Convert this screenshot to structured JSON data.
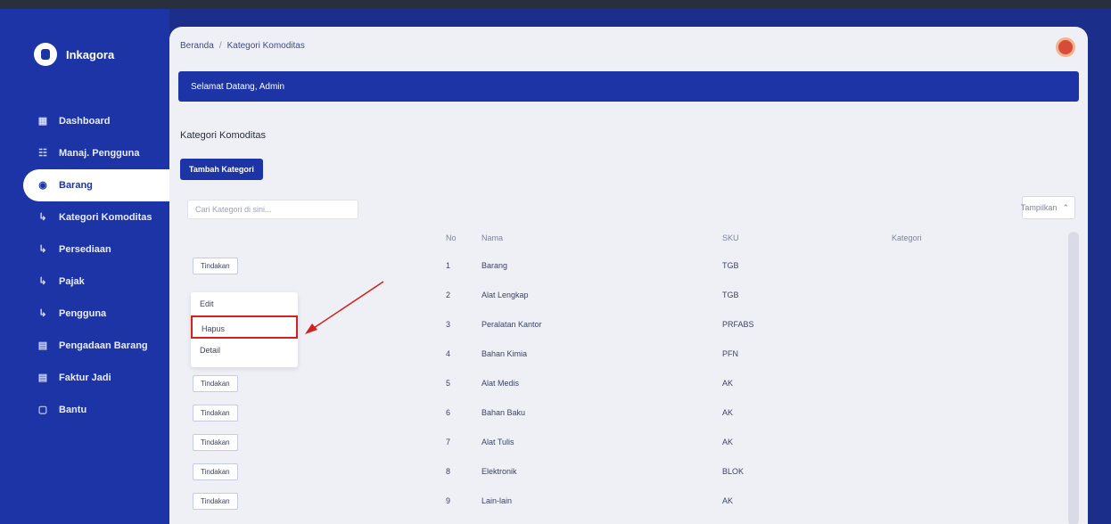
{
  "app": {
    "name": "Inkagora"
  },
  "sidebar": {
    "items": [
      {
        "label": "Dashboard",
        "icon": "grid-icon"
      },
      {
        "label": "Manaj. Pengguna",
        "icon": "users-icon"
      },
      {
        "label": "Barang",
        "icon": "box-icon"
      },
      {
        "label": "Kategori Komoditas",
        "icon": "tag-icon"
      },
      {
        "label": "Persediaan",
        "icon": "list-icon"
      },
      {
        "label": "Pajak",
        "icon": "tag-icon"
      },
      {
        "label": "Pengguna",
        "icon": "user-icon"
      },
      {
        "label": "Pengadaan Barang",
        "icon": "cart-icon"
      },
      {
        "label": "Faktur Jadi",
        "icon": "doc-icon"
      },
      {
        "label": "Bantu",
        "icon": "help-icon"
      }
    ]
  },
  "breadcrumb": {
    "home": "Beranda",
    "current": "Kategori Komoditas"
  },
  "banner": {
    "text": "Selamat Datang, Admin"
  },
  "page": {
    "title": "Kategori Komoditas",
    "add_button": "Tambah Kategori"
  },
  "search": {
    "placeholder": "Cari Kategori di sini..."
  },
  "table_ctrl": {
    "label": "Tampilkan"
  },
  "table": {
    "headers": {
      "action": "",
      "no": "No",
      "nama": "Nama",
      "sku": "SKU",
      "kategori": "Kategori"
    },
    "rows": [
      {
        "action": "Tindakan",
        "no": "1",
        "nama": "Barang",
        "sku": "TGB",
        "kategori": ""
      },
      {
        "action": "",
        "no": "2",
        "nama": "Alat Lengkap",
        "sku": "TGB",
        "kategori": ""
      },
      {
        "action": "",
        "no": "3",
        "nama": "Peralatan Kantor",
        "sku": "PRFABS",
        "kategori": ""
      },
      {
        "action": "",
        "no": "4",
        "nama": "Bahan Kimia",
        "sku": "PFN",
        "kategori": ""
      },
      {
        "action": "Tindakan",
        "no": "5",
        "nama": "Alat Medis",
        "sku": "AK",
        "kategori": ""
      },
      {
        "action": "Tindakan",
        "no": "6",
        "nama": "Bahan Baku",
        "sku": "AK",
        "kategori": ""
      },
      {
        "action": "Tindakan",
        "no": "7",
        "nama": "Alat Tulis",
        "sku": "AK",
        "kategori": ""
      },
      {
        "action": "Tindakan",
        "no": "8",
        "nama": "Elektronik",
        "sku": "BLOK",
        "kategori": ""
      },
      {
        "action": "Tindakan",
        "no": "9",
        "nama": "Lain-lain",
        "sku": "AK",
        "kategori": ""
      }
    ]
  },
  "dropdown": {
    "items": [
      {
        "label": "Edit"
      },
      {
        "label": "Hapus"
      },
      {
        "label": "Detail"
      }
    ]
  }
}
